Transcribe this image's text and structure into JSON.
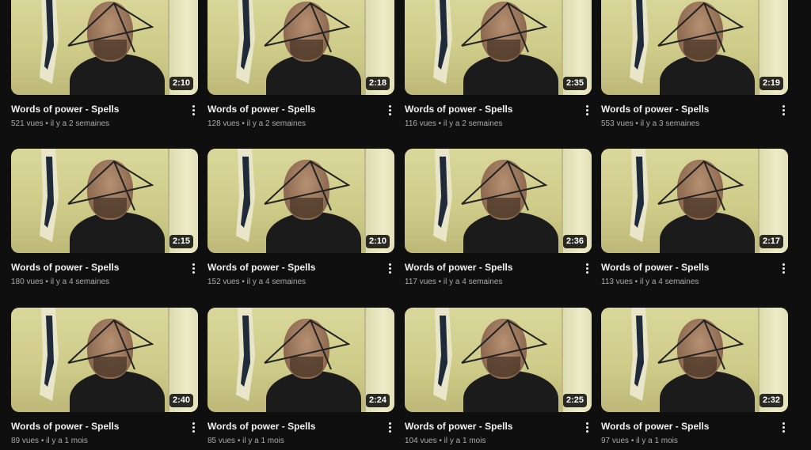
{
  "videos": [
    {
      "title": "Words of power - Spells",
      "duration": "2:10",
      "views": "521 vues",
      "age": "il y a 2 semaines"
    },
    {
      "title": "Words of power - Spells",
      "duration": "2:18",
      "views": "128 vues",
      "age": "il y a 2 semaines"
    },
    {
      "title": "Words of power - Spells",
      "duration": "2:35",
      "views": "116 vues",
      "age": "il y a 2 semaines"
    },
    {
      "title": "Words of power - Spells",
      "duration": "2:19",
      "views": "553 vues",
      "age": "il y a 3 semaines"
    },
    {
      "title": "Words of power - Spells",
      "duration": "2:15",
      "views": "180 vues",
      "age": "il y a 4 semaines"
    },
    {
      "title": "Words of power - Spells",
      "duration": "2:10",
      "views": "152 vues",
      "age": "il y a 4 semaines"
    },
    {
      "title": "Words of power - Spells",
      "duration": "2:36",
      "views": "117 vues",
      "age": "il y a 4 semaines"
    },
    {
      "title": "Words of power - Spells",
      "duration": "2:17",
      "views": "113 vues",
      "age": "il y a 4 semaines"
    },
    {
      "title": "Words of power - Spells",
      "duration": "2:40",
      "views": "89 vues",
      "age": "il y a 1 mois"
    },
    {
      "title": "Words of power - Spells",
      "duration": "2:24",
      "views": "85 vues",
      "age": "il y a 1 mois"
    },
    {
      "title": "Words of power - Spells",
      "duration": "2:25",
      "views": "104 vues",
      "age": "il y a 1 mois"
    },
    {
      "title": "Words of power - Spells",
      "duration": "2:32",
      "views": "97 vues",
      "age": "il y a 1 mois"
    }
  ],
  "separator": "•",
  "icons": {
    "more": "more-vert-icon"
  }
}
